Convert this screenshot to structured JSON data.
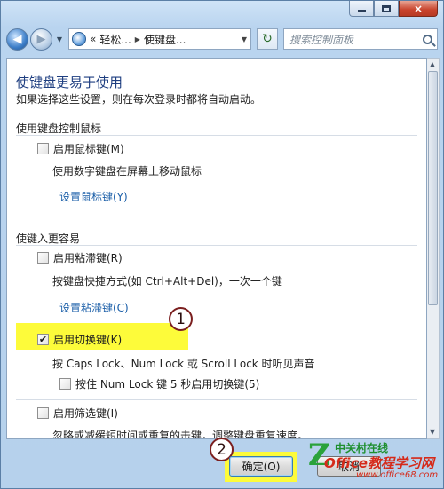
{
  "window": {
    "caption": {
      "minimize": "minimize",
      "maximize": "maximize",
      "close": "×"
    }
  },
  "addressbar": {
    "crumb_prefix": "«",
    "crumb1": "轻松...",
    "crumb2": "使键盘...",
    "search_placeholder": "搜索控制面板"
  },
  "page": {
    "title": "使键盘更易于使用",
    "description": "如果选择这些设置，则在每次登录时都将自动启动。"
  },
  "groups": [
    {
      "title": "使用键盘控制鼠标",
      "items": [
        {
          "label": "启用鼠标键(M)",
          "checked": false,
          "description": "使用数字键盘在屏幕上移动鼠标",
          "link": "设置鼠标键(Y)"
        }
      ]
    },
    {
      "title": "使键入更容易",
      "items": [
        {
          "label": "启用粘滞键(R)",
          "checked": false,
          "description": "按键盘快捷方式(如 Ctrl+Alt+Del)，一次一个键",
          "link": "设置粘滞键(C)"
        },
        {
          "label": "启用切换键(K)",
          "checked": true,
          "description": "按 Caps Lock、Num Lock 或 Scroll Lock 时听见声音",
          "sub_option": {
            "label": "按住 Num Lock 键 5 秒启用切换键(5)",
            "checked": false
          }
        },
        {
          "label": "启用筛选键(I)",
          "checked": false,
          "description": "忽略或减缓短时间或重复的击键，调整键盘重复速度。"
        }
      ]
    }
  ],
  "annotations": {
    "step1": "1",
    "step2": "2"
  },
  "footer": {
    "ok_label": "确定(O)",
    "cancel_label": "取消"
  },
  "watermark": {
    "logo": "Z",
    "line1": "中关村在线",
    "line2": "Office教程学习网",
    "url": "www.office68.com"
  },
  "colors": {
    "highlight": "#fdfb3a",
    "link": "#1a5ea8",
    "title": "#1e3e80"
  }
}
